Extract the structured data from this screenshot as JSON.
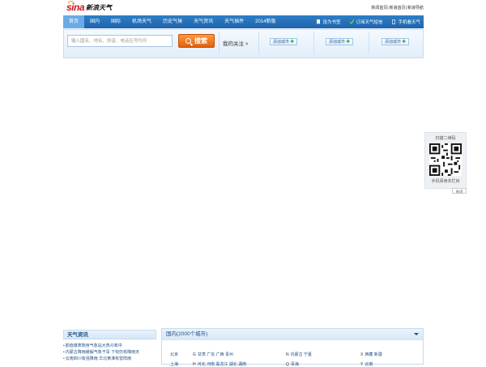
{
  "logo": {
    "mark": "sina",
    "text": "新浪天气"
  },
  "top_links": [
    "新闻首页",
    "新浪首页",
    "新浪导航"
  ],
  "nav": {
    "items": [
      "首页",
      "国内",
      "国际",
      "机场天气",
      "历史气候",
      "天气资讯",
      "天气插件",
      "2014新版"
    ],
    "active_index": 0,
    "right_links": [
      {
        "label": "设为书签",
        "icon": "bookmark-icon"
      },
      {
        "label": "订阅天气短信",
        "icon": "sms-icon"
      },
      {
        "label": "手机看天气",
        "icon": "phone-icon"
      }
    ]
  },
  "search": {
    "placeholder": "输入国名、地名、拼音、电话区号均可",
    "button_label": "搜索"
  },
  "follow": {
    "label": "我的关注 >",
    "add_city_label": "添加城市",
    "slots": 3
  },
  "qr": {
    "title": "扫描二维码",
    "footer": "手机阅读本栏目",
    "close_label": "关闭"
  },
  "news": {
    "title": "天气资讯",
    "items": [
      "颜值爆表随身气象站大热众筹中",
      "内蒙古降雨缓解气象干旱 下旬仍有降雨天",
      "云南四川有强降雨 华北黄淮有雷阵雨"
    ]
  },
  "domestic": {
    "title": "国内(2000个城市)",
    "rows": [
      [
        {
          "letter": "",
          "cities": "北京"
        },
        {
          "letter": "G",
          "cities": "甘肃 广东 广西 贵州"
        },
        {
          "letter": "N",
          "cities": "内蒙古 宁夏"
        },
        {
          "letter": "X",
          "cities": "西藏 新疆"
        }
      ],
      [
        {
          "letter": "",
          "cities": "上海"
        },
        {
          "letter": "H",
          "cities": "河北 河南 黑龙江 湖北 湖南"
        },
        {
          "letter": "Q",
          "cities": "青海"
        },
        {
          "letter": "Y",
          "cities": "云南"
        }
      ]
    ]
  }
}
